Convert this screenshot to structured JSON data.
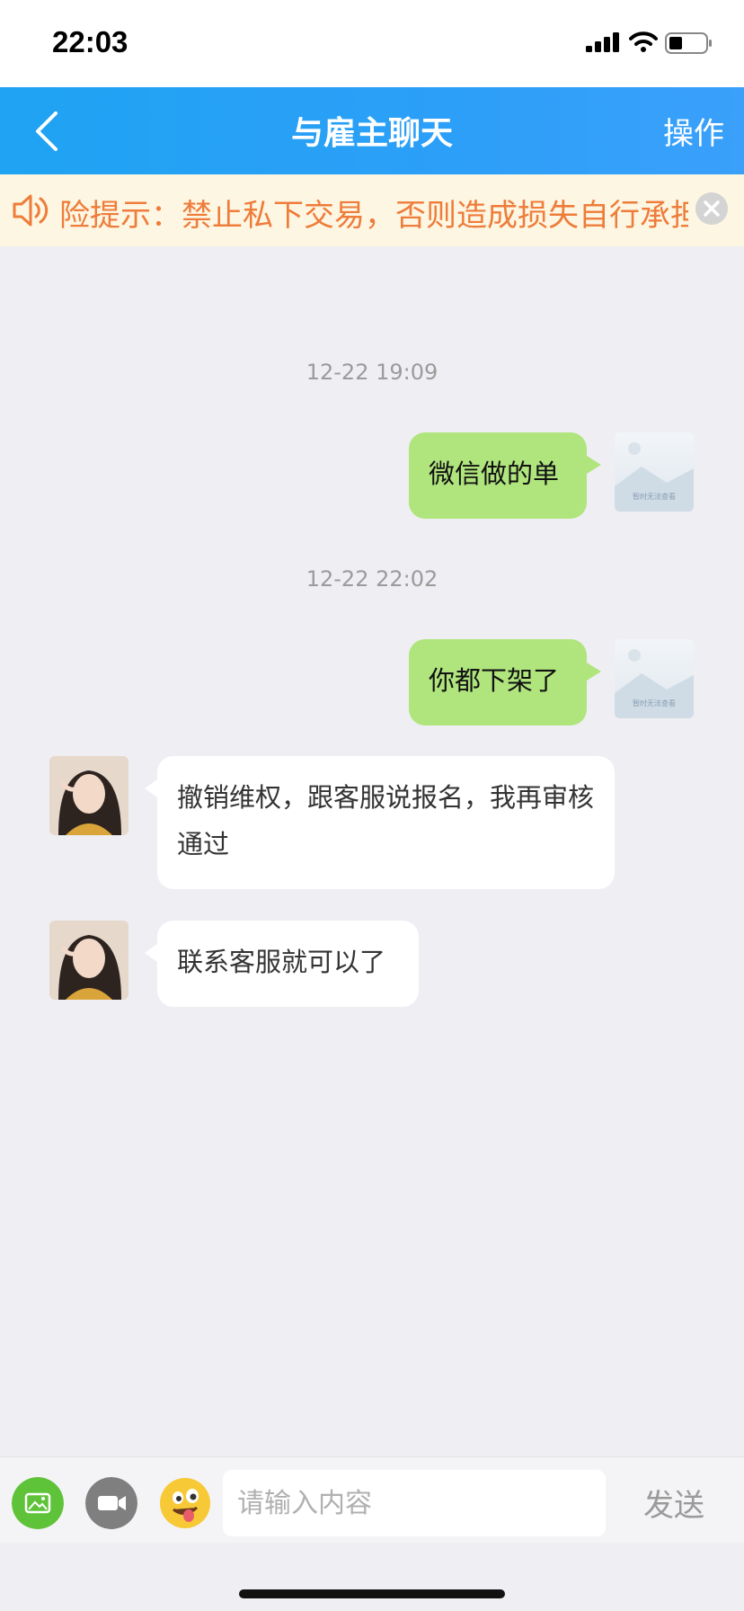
{
  "status_bar": {
    "time": "22:03"
  },
  "nav": {
    "title": "与雇主聊天",
    "action_label": "操作"
  },
  "notice": {
    "text": "险提示：禁止私下交易，否则造成损失自行承担"
  },
  "messages": [
    {
      "timestamp": "12-22 19:09",
      "from": "me",
      "text": "微信做的单"
    },
    {
      "timestamp": "12-22 22:02",
      "from": "me",
      "text": "你都下架了"
    },
    {
      "from": "employer",
      "text": "撤销维权，跟客服说报名，我再审核通过"
    },
    {
      "from": "employer",
      "text": "联系客服就可以了"
    }
  ],
  "avatar_placeholder_caption": "暂时无法查看",
  "input": {
    "placeholder": "请输入内容",
    "send_label": "发送"
  },
  "colors": {
    "nav": "#2c9ff8",
    "notice_text": "#ee7c3a",
    "my_bubble": "#b0e57e",
    "image_button": "#5fc339"
  },
  "icons": [
    "back-icon",
    "speaker-icon",
    "close-icon",
    "image-icon",
    "video-icon",
    "emoji-icon"
  ]
}
